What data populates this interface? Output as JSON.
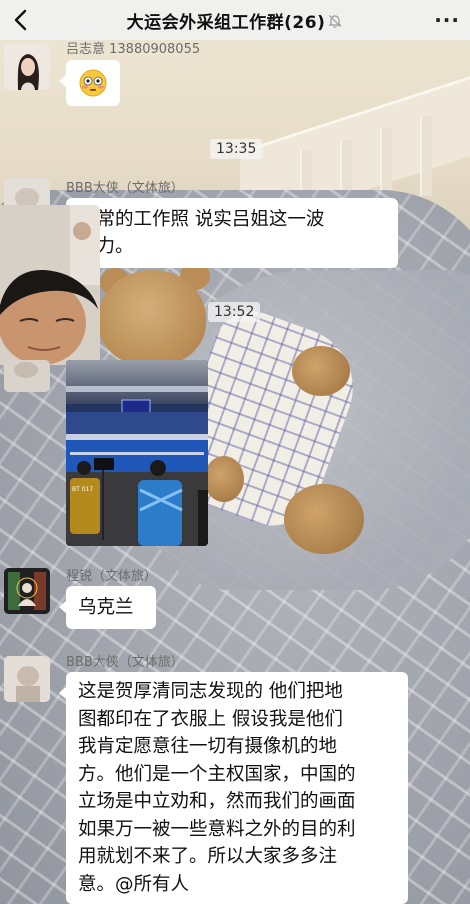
{
  "header": {
    "title": "大运会外采组工作群(26)",
    "back_icon": "back-chevron-icon",
    "mute_icon": "bell-muted-icon",
    "more_label": "···"
  },
  "messages": [
    {
      "sender": "吕志意 13880908055",
      "content": "😳",
      "type": "emoji"
    },
    {
      "time": "13:35"
    },
    {
      "sender": "BBB大侠（文体旅）",
      "content_lines": [
        "正常的工作照 说实吕姐这一波",
        "给力。"
      ],
      "type": "text"
    },
    {
      "time": "13:52"
    },
    {
      "type": "image",
      "image_desc": "photo-stadium-volleyball"
    },
    {
      "sender": "程锐（文体旅）",
      "content": "乌克兰",
      "type": "text"
    },
    {
      "sender": "BBB大侠（文体旅）",
      "content_lines": [
        "这是贺厚清同志发现的 他们把地",
        "图都印在了衣服上 假设我是他们",
        "我肯定愿意往一切有摄像机的地",
        "方。他们是一个主权国家，中国的",
        "立场是中立劝和，然而我们的画面",
        "如果万一被一些意料之外的目的利",
        "用就划不来了。所以大家多多注",
        "意。@所有人"
      ],
      "type": "text"
    }
  ],
  "photo": {
    "scoreboard_text": "",
    "badge_text": "BT 017"
  }
}
